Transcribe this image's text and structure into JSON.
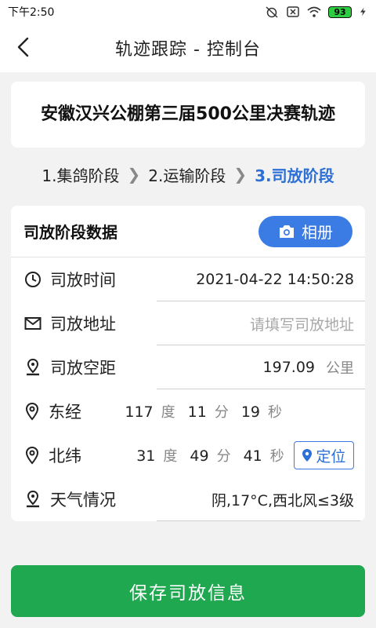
{
  "status_bar": {
    "time": "下午2:50",
    "battery": "93",
    "icons": [
      "alarm-off-icon",
      "no-sim-icon",
      "wifi-icon",
      "battery-icon",
      "charging-icon"
    ]
  },
  "header": {
    "title": "轨迹跟踪 - 控制台",
    "back_icon": "chevron-left-icon"
  },
  "race": {
    "name": "安徽汉兴公棚第三届500公里决赛轨迹"
  },
  "steps": [
    {
      "label": "1.集鸽阶段",
      "active": false
    },
    {
      "label": "2.运输阶段",
      "active": false
    },
    {
      "label": "3.司放阶段",
      "active": true
    }
  ],
  "release": {
    "section_title": "司放阶段数据",
    "album_button": "相册",
    "time_label": "司放时间",
    "time_value": "2021-04-22 14:50:28",
    "address_label": "司放地址",
    "address_placeholder": "请填写司放地址",
    "distance_label": "司放空距",
    "distance_value": "197.09",
    "distance_unit": "公里",
    "longitude_label": "东经",
    "longitude": {
      "deg": "117",
      "min": "11",
      "sec": "19"
    },
    "latitude_label": "北纬",
    "latitude": {
      "deg": "31",
      "min": "49",
      "sec": "41"
    },
    "unit_deg": "度",
    "unit_min": "分",
    "unit_sec": "秒",
    "locate_button": "定位",
    "weather_label": "天气情况",
    "weather_value": "阴,17°C,西北风≤3级"
  },
  "save_button": "保存司放信息",
  "colors": {
    "accent_blue": "#3a7be4",
    "active_step": "#2c6fd6",
    "save_green": "#1fa84f",
    "background": "#f2f2f2"
  }
}
